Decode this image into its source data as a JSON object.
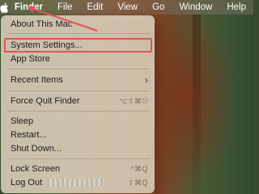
{
  "menubar": {
    "items": [
      {
        "label": "Finder"
      },
      {
        "label": "File"
      },
      {
        "label": "Edit"
      },
      {
        "label": "View"
      },
      {
        "label": "Go"
      },
      {
        "label": "Window"
      },
      {
        "label": "Help"
      }
    ]
  },
  "apple_menu": {
    "about": "About This Mac",
    "system_settings": "System Settings...",
    "app_store": "App Store",
    "recent_items": "Recent Items",
    "force_quit": "Force Quit Finder",
    "force_quit_shortcut": "⌥⇧⌘⎋",
    "sleep": "Sleep",
    "restart": "Restart...",
    "shut_down": "Shut Down...",
    "lock_screen": "Lock Screen",
    "lock_screen_shortcut": "^⌘Q",
    "log_out": "Log Out",
    "log_out_shortcut": "⇧⌘Q"
  },
  "icons": {
    "apple": "apple-logo-icon",
    "submenu": "chevron-right-icon"
  },
  "colors": {
    "highlight": "#e0555a"
  }
}
